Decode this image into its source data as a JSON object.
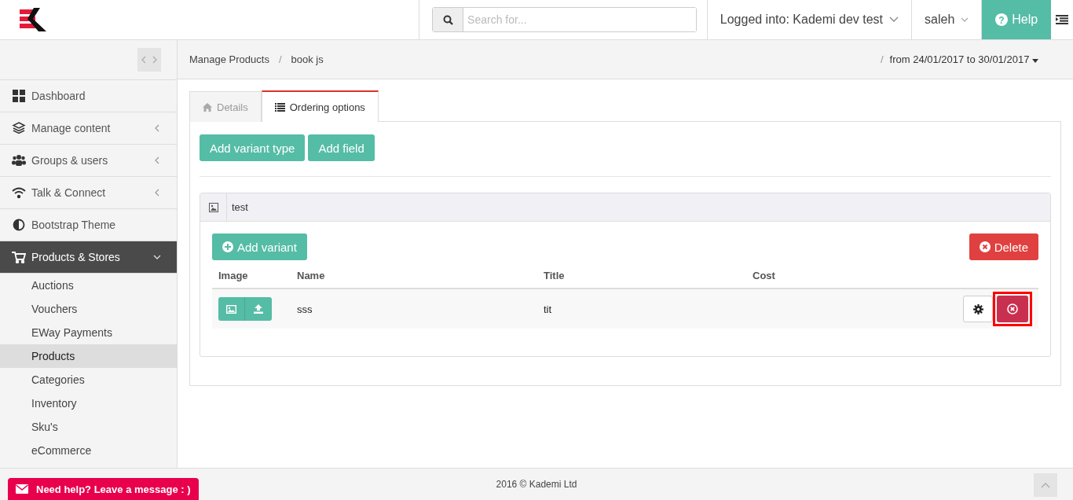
{
  "header": {
    "search": {
      "placeholder": "Search for..."
    },
    "account": "Logged into: Kademi dev test",
    "user": "saleh",
    "help_icon": "?",
    "help": "Help"
  },
  "breadcrumb": {
    "items": [
      "Manage Products",
      "book js"
    ],
    "separator": "/"
  },
  "date_separator": "/",
  "date_range": "from 24/01/2017 to 30/01/2017",
  "sidebar": {
    "items": [
      {
        "label": "Dashboard",
        "has_submenu": false,
        "expanded": false
      },
      {
        "label": "Manage content",
        "has_submenu": true,
        "expanded": false
      },
      {
        "label": "Groups & users",
        "has_submenu": true,
        "expanded": false
      },
      {
        "label": "Talk & Connect",
        "has_submenu": true,
        "expanded": false
      },
      {
        "label": "Bootstrap Theme",
        "has_submenu": false,
        "expanded": false
      },
      {
        "label": "Products & Stores",
        "has_submenu": true,
        "expanded": true,
        "children": [
          {
            "label": "Auctions",
            "selected": false
          },
          {
            "label": "Vouchers",
            "selected": false
          },
          {
            "label": "EWay Payments",
            "selected": false
          },
          {
            "label": "Products",
            "selected": true
          },
          {
            "label": "Categories",
            "selected": false
          },
          {
            "label": "Inventory",
            "selected": false
          },
          {
            "label": "Sku's",
            "selected": false
          },
          {
            "label": "eCommerce",
            "selected": false
          }
        ]
      }
    ]
  },
  "tabs": [
    {
      "label": "Details",
      "selected": false
    },
    {
      "label": "Ordering options",
      "selected": true
    }
  ],
  "actions": [
    "Add variant type",
    "Add field"
  ],
  "variant_panel": {
    "title": "test",
    "add_button": "Add variant",
    "delete_button": "Delete",
    "columns": [
      "Image",
      "Name",
      "Title",
      "Cost"
    ],
    "rows": [
      {
        "name": "sss",
        "title": "tit",
        "delete_highlighted": true
      }
    ]
  },
  "footer": {
    "copyright": "2016 © Kademi Ltd",
    "chat": "Need help? Leave a message : )"
  }
}
